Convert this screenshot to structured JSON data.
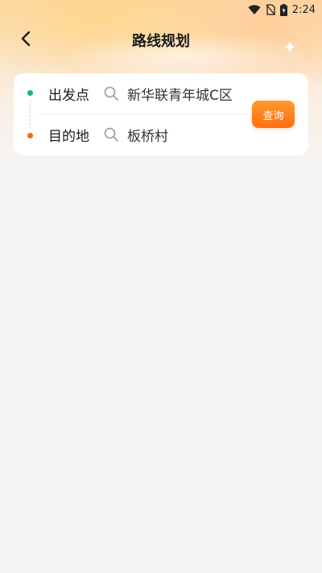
{
  "status_bar": {
    "time": "2:24",
    "icons": [
      "wifi-icon",
      "no-sim-icon",
      "battery-charging-icon"
    ]
  },
  "header": {
    "title": "路线规划",
    "back_icon": "chevron-left-icon"
  },
  "route_form": {
    "origin": {
      "label": "出发点",
      "value": "新华联青年城C区",
      "dot_color": "#1fb36b",
      "icon": "search-icon"
    },
    "destination": {
      "label": "目的地",
      "value": "板桥村",
      "dot_color": "#f26b1d",
      "icon": "search-icon"
    },
    "query_button": "查询"
  },
  "colors": {
    "accent": "#ff7a1a",
    "background": "#f4f5f7"
  }
}
